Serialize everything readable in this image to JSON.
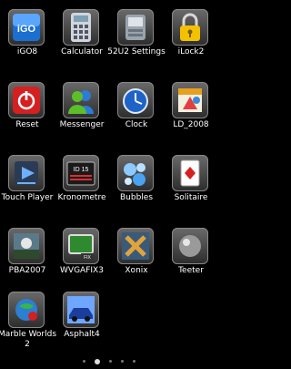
{
  "apps": [
    {
      "label": "iGO8",
      "icon": "igo-icon"
    },
    {
      "label": "Calculator",
      "icon": "calculator-icon"
    },
    {
      "label": "52U2 Settings",
      "icon": "settings-icon"
    },
    {
      "label": "iLock2",
      "icon": "lock-icon"
    },
    {
      "label": "Reset",
      "icon": "power-icon"
    },
    {
      "label": "Messenger",
      "icon": "messenger-icon"
    },
    {
      "label": "Clock",
      "icon": "clock-icon"
    },
    {
      "label": "LD_2008",
      "icon": "ld-icon"
    },
    {
      "label": "Touch Player",
      "icon": "player-icon"
    },
    {
      "label": "Kronometre",
      "icon": "stopwatch-icon"
    },
    {
      "label": "Bubbles",
      "icon": "bubbles-icon"
    },
    {
      "label": "Solitaire",
      "icon": "cards-icon"
    },
    {
      "label": "PBA2007",
      "icon": "pba-icon"
    },
    {
      "label": "WVGAFIX3",
      "icon": "wvgafix-icon"
    },
    {
      "label": "Xonix",
      "icon": "xonix-icon"
    },
    {
      "label": "Teeter",
      "icon": "ball-icon"
    },
    {
      "label": "Marble Worlds 2",
      "icon": "marble-icon"
    },
    {
      "label": "Asphalt4",
      "icon": "car-icon"
    }
  ],
  "icon_text": {
    "igo": "iGO",
    "kron": "ID 15",
    "fix": "FIX"
  },
  "pager": {
    "pages": 5,
    "current": 1
  }
}
